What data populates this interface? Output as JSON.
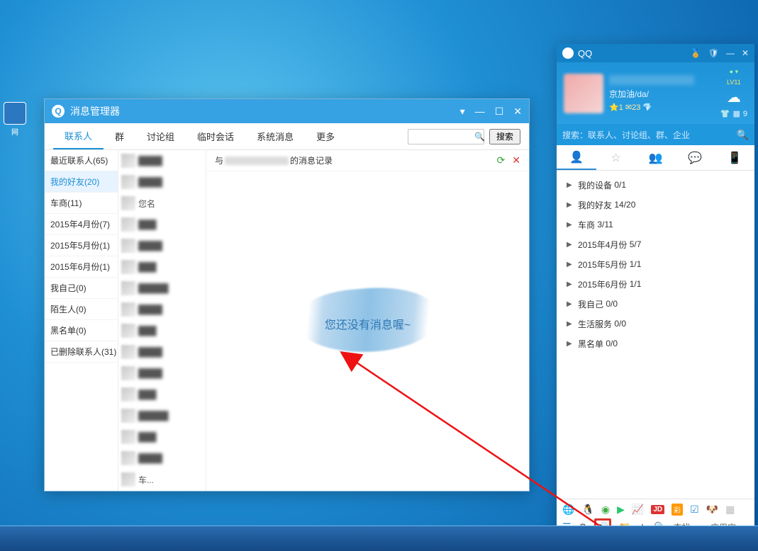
{
  "desktop": {
    "icon1_label": "网"
  },
  "mm": {
    "title": "消息管理器",
    "win_menu": "▾",
    "win_min": "—",
    "win_max": "☐",
    "win_close": "✕",
    "tabs": {
      "contacts": "联系人",
      "groups": "群",
      "discuss": "讨论组",
      "temp": "临时会话",
      "system": "系统消息",
      "more": "更多"
    },
    "search_placeholder": "",
    "search_button": "搜索",
    "categories": [
      "最近联系人(65)",
      "我的好友(20)",
      "车商(11)",
      "2015年4月份(7)",
      "2015年5月份(1)",
      "2015年6月份(1)",
      "我自己(0)",
      "陌生人(0)",
      "黑名单(0)",
      "已删除联系人(31)"
    ],
    "active_category_index": 1,
    "contacts_visible": {
      "clear_name": "您名",
      "last_name": "车..."
    },
    "content_head_prefix": "与",
    "content_head_suffix": "的消息记录",
    "no_msg_text": "您还没有消息喔~"
  },
  "qq": {
    "title": "QQ",
    "win_min": "—",
    "win_max": "☐",
    "win_close": "✕",
    "level": "LV11",
    "signature": "京加油/da/",
    "stat_star": "1",
    "stat_mail": "23",
    "coin_tee": "",
    "coin_grid": "9",
    "search_hint": "搜索：联系人、讨论组、群、企业",
    "groups": [
      {
        "name": "我的设备",
        "count": "0/1"
      },
      {
        "name": "我的好友",
        "count": "14/20"
      },
      {
        "name": "车商",
        "count": "3/11"
      },
      {
        "name": "2015年4月份",
        "count": "5/7"
      },
      {
        "name": "2015年5月份",
        "count": "1/1"
      },
      {
        "name": "2015年6月份",
        "count": "1/1"
      },
      {
        "name": "我自己",
        "count": "0/0"
      },
      {
        "name": "生活服务",
        "count": "0/0"
      },
      {
        "name": "黑名单",
        "count": "0/0"
      }
    ],
    "footer_find": "查找",
    "footer_app": "应用宝"
  }
}
